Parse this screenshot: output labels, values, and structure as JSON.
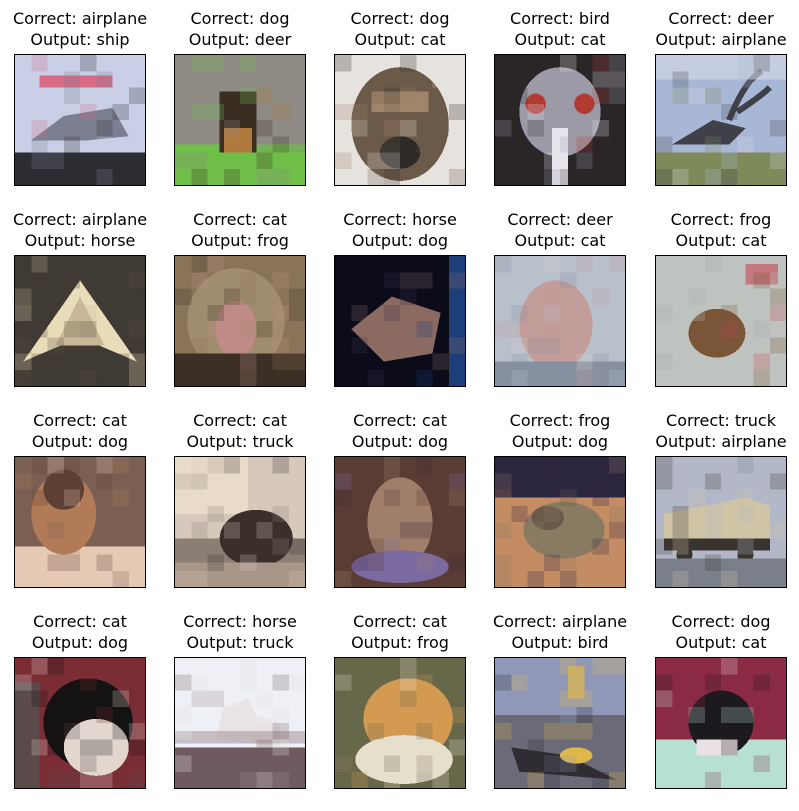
{
  "figure": {
    "panels": [
      {
        "correct": "Correct: airplane",
        "output": "Output: ship",
        "image_subject": "airplane-on-ground",
        "colors": [
          "#c9cfe6",
          "#2c2c33",
          "#7b7f91",
          "#d96a86"
        ]
      },
      {
        "correct": "Correct: dog",
        "output": "Output: deer",
        "image_subject": "small-dog-on-grass",
        "colors": [
          "#8e8b85",
          "#6fbe48",
          "#3a2d22",
          "#b07a3f"
        ]
      },
      {
        "correct": "Correct: dog",
        "output": "Output: cat",
        "image_subject": "dog-face-closeup",
        "colors": [
          "#e6e2de",
          "#6c5a48",
          "#2d2a28",
          "#a0856a"
        ]
      },
      {
        "correct": "Correct: bird",
        "output": "Output: cat",
        "image_subject": "ostrich-head-closeup",
        "colors": [
          "#2a2628",
          "#9b9aa6",
          "#b13a33",
          "#e8e4ec"
        ]
      },
      {
        "correct": "Correct: deer",
        "output": "Output: airplane",
        "image_subject": "deer-antler-sculpture",
        "colors": [
          "#a9b7d6",
          "#404049",
          "#7e8a5a",
          "#d8dde8"
        ]
      },
      {
        "correct": "Correct: airplane",
        "output": "Output: horse",
        "image_subject": "flying-wing-aircraft",
        "colors": [
          "#3f3a34",
          "#e9dcb8",
          "#5b5145",
          "#c9b897"
        ]
      },
      {
        "correct": "Correct: cat",
        "output": "Output: frog",
        "image_subject": "yawning-cat",
        "colors": [
          "#8a7458",
          "#3c2f25",
          "#c08a86",
          "#a08c6e"
        ]
      },
      {
        "correct": "Correct: horse",
        "output": "Output: dog",
        "image_subject": "horse-head-dark",
        "colors": [
          "#0b0b1a",
          "#8b6a62",
          "#3c3446",
          "#1c3f7a"
        ]
      },
      {
        "correct": "Correct: deer",
        "output": "Output: cat",
        "image_subject": "deer-closeup",
        "colors": [
          "#b8c0cc",
          "#c39d9a",
          "#8790a0",
          "#d8cac6"
        ]
      },
      {
        "correct": "Correct: frog",
        "output": "Output: cat",
        "image_subject": "frog-on-ground",
        "colors": [
          "#bfc3c0",
          "#7a5538",
          "#a7aaa8",
          "#c4464e"
        ]
      },
      {
        "correct": "Correct: cat",
        "output": "Output: dog",
        "image_subject": "cat-sitting",
        "colors": [
          "#7a5f52",
          "#e6c9b4",
          "#5c4034",
          "#b07b56"
        ]
      },
      {
        "correct": "Correct: cat",
        "output": "Output: truck",
        "image_subject": "cat-by-window",
        "colors": [
          "#d6c9bc",
          "#3a2f2b",
          "#8b7e74",
          "#a89788"
        ]
      },
      {
        "correct": "Correct: cat",
        "output": "Output: dog",
        "image_subject": "cat-in-basket",
        "colors": [
          "#5a3c34",
          "#a07e6a",
          "#3b2736",
          "#7a6aa0"
        ]
      },
      {
        "correct": "Correct: frog",
        "output": "Output: dog",
        "image_subject": "frog-closeup",
        "colors": [
          "#2c2540",
          "#c38c63",
          "#8a7a62",
          "#6b5a4a"
        ]
      },
      {
        "correct": "Correct: truck",
        "output": "Output: airplane",
        "image_subject": "truck-trailer",
        "colors": [
          "#b3b8c9",
          "#cfc4a6",
          "#3a3430",
          "#7a7f8a"
        ]
      },
      {
        "correct": "Correct: cat",
        "output": "Output: dog",
        "image_subject": "black-white-cat",
        "colors": [
          "#7a2d34",
          "#141212",
          "#e2d7cf",
          "#5a4a4a"
        ]
      },
      {
        "correct": "Correct: horse",
        "output": "Output: truck",
        "image_subject": "white-horse",
        "colors": [
          "#eef0f5",
          "#e8e4e6",
          "#6f5a5f",
          "#9c8a8e"
        ]
      },
      {
        "correct": "Correct: cat",
        "output": "Output: frog",
        "image_subject": "orange-cat-closeup",
        "colors": [
          "#67684a",
          "#d49a52",
          "#e6dfcc",
          "#8b7a62"
        ]
      },
      {
        "correct": "Correct: airplane",
        "output": "Output: bird",
        "image_subject": "aircraft-cockpit",
        "colors": [
          "#8f98b8",
          "#2f2c33",
          "#e0b84a",
          "#6a6a78"
        ]
      },
      {
        "correct": "Correct: dog",
        "output": "Output: cat",
        "image_subject": "small-dog-on-blanket",
        "colors": [
          "#8b2a45",
          "#1c1a1f",
          "#b6e0d2",
          "#e9e1e6"
        ]
      }
    ]
  }
}
